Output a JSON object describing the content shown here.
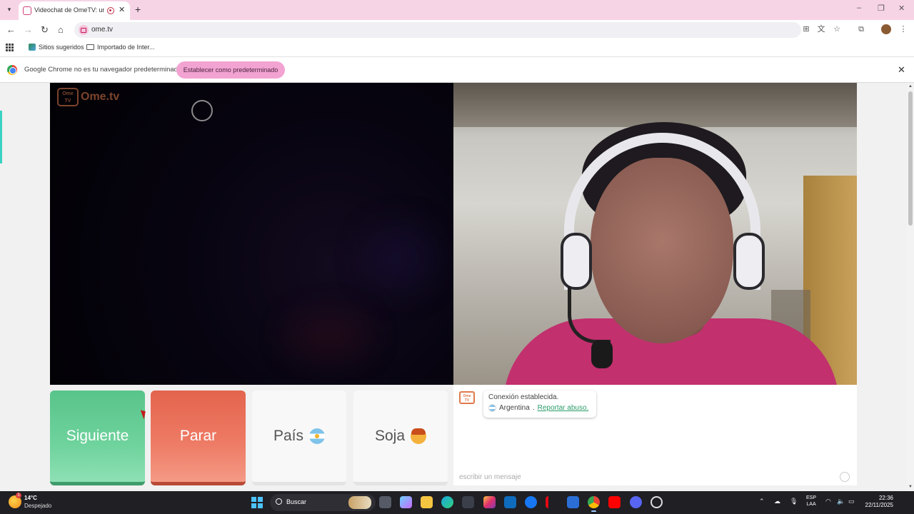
{
  "browser": {
    "tab_title": "Videochat de OmeTV: una",
    "url": "ome.tv",
    "bookmarks": [
      {
        "label": "Sitios sugeridos"
      },
      {
        "label": "Importado de Inter..."
      }
    ],
    "infobar": {
      "message": "Google Chrome no es tu navegador predeterminado",
      "button_label": "Establecer como predeterminado"
    }
  },
  "site": {
    "logo_text": "Ome.tv",
    "logo_box_text": "Ome TV"
  },
  "controls": {
    "next_label": "Siguiente",
    "stop_label": "Parar",
    "country_label": "País",
    "gender_label": "Soja",
    "accent_next": "#58c48a",
    "accent_stop": "#e4644d"
  },
  "chat": {
    "status_message": "Conexión establecida.",
    "country": "Argentina",
    "separator": ".",
    "report_link": "Reportar abuso.",
    "input_placeholder": "escribir un mensaje"
  },
  "taskbar": {
    "weather_temp": "14°C",
    "weather_desc": "Despejado",
    "weather_badge": "1",
    "search_label": "Buscar",
    "lang_line1": "ESP",
    "lang_line2": "LAA",
    "time": "22:36",
    "date": "22/11/2025",
    "apps": [
      "task-view-icon",
      "copilot-icon",
      "file-explorer-icon",
      "edge-icon",
      "store-icon",
      "instagram-icon",
      "mail-icon",
      "facebook-icon",
      "netflix-icon",
      "calculator-icon",
      "chrome-icon",
      "youtube-icon",
      "discord-icon",
      "chatgpt-icon"
    ]
  }
}
